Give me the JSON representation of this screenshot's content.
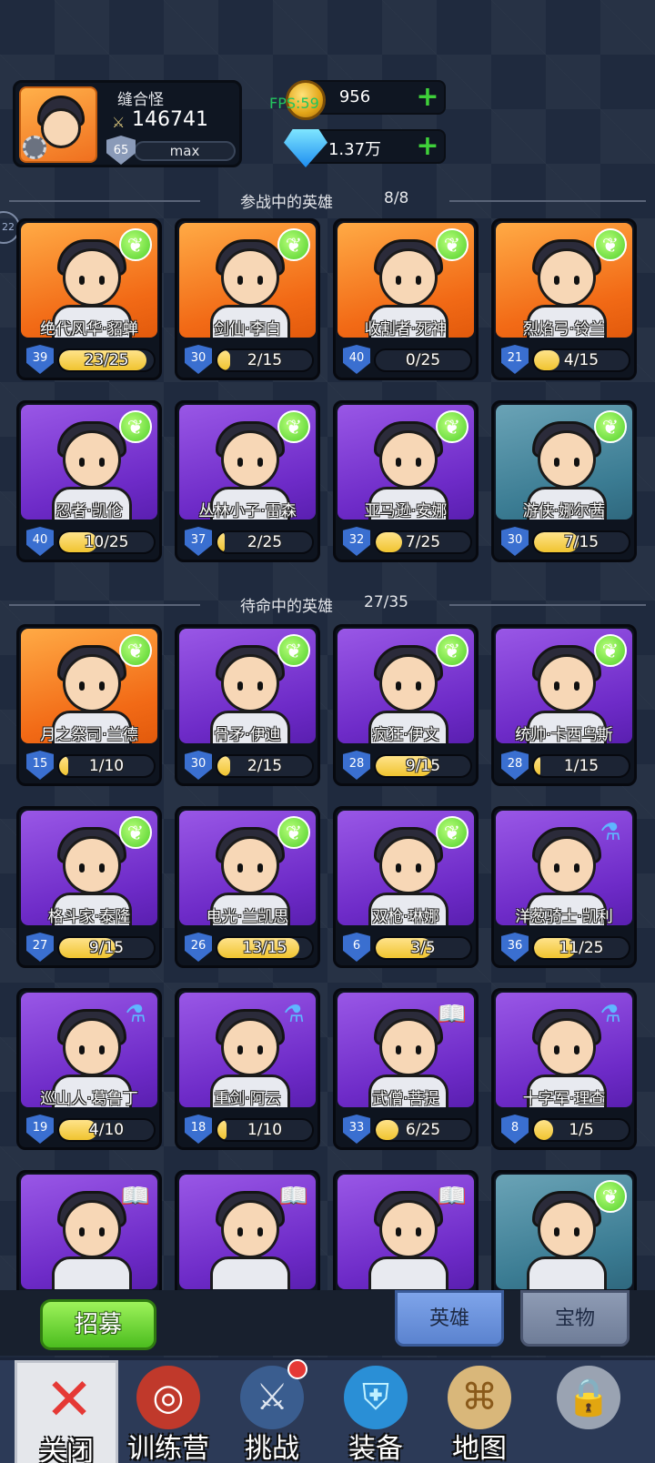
{
  "profile": {
    "name": "缝合怪",
    "power": "146741",
    "level": "65",
    "level_status": "max"
  },
  "currency": {
    "fps": "FPS:59",
    "gold": "956",
    "gems": "1.37万"
  },
  "side_tab": "22",
  "active_section": {
    "title": "参战中的英雄",
    "count": "8/8"
  },
  "standby_section": {
    "title": "待命中的英雄",
    "count": "27/35"
  },
  "active_heroes": [
    {
      "name": "绝代风华·貂蝉",
      "level": "39",
      "progress": "23/25",
      "fill": 0.92,
      "rarity": "orange",
      "badge": "leaf"
    },
    {
      "name": "剑仙·李白",
      "level": "30",
      "progress": "2/15",
      "fill": 0.13,
      "rarity": "orange",
      "badge": "leaf"
    },
    {
      "name": "收割者·死神",
      "level": "40",
      "progress": "0/25",
      "fill": 0.0,
      "rarity": "orange",
      "badge": "leaf"
    },
    {
      "name": "烈焰弓·铃兰",
      "level": "21",
      "progress": "4/15",
      "fill": 0.27,
      "rarity": "orange",
      "badge": "leaf"
    },
    {
      "name": "忍者·凯伦",
      "level": "40",
      "progress": "10/25",
      "fill": 0.4,
      "rarity": "purple",
      "badge": "leaf"
    },
    {
      "name": "丛林小子·雷森",
      "level": "37",
      "progress": "2/25",
      "fill": 0.08,
      "rarity": "purple",
      "badge": "leaf"
    },
    {
      "name": "亚马逊·安娜",
      "level": "32",
      "progress": "7/25",
      "fill": 0.28,
      "rarity": "purple",
      "badge": "leaf"
    },
    {
      "name": "游侠·娜尔茜",
      "level": "30",
      "progress": "7/15",
      "fill": 0.47,
      "rarity": "teal",
      "badge": "leaf"
    }
  ],
  "standby_heroes": [
    {
      "name": "月之祭司·兰德",
      "level": "15",
      "progress": "1/10",
      "fill": 0.1,
      "rarity": "orange",
      "badge": "leaf"
    },
    {
      "name": "骨矛·伊迪",
      "level": "30",
      "progress": "2/15",
      "fill": 0.13,
      "rarity": "purple",
      "badge": "leaf"
    },
    {
      "name": "疯狂·伊文",
      "level": "28",
      "progress": "9/15",
      "fill": 0.6,
      "rarity": "purple",
      "badge": "leaf"
    },
    {
      "name": "统帅·卡西乌斯",
      "level": "28",
      "progress": "1/15",
      "fill": 0.07,
      "rarity": "purple",
      "badge": "leaf"
    },
    {
      "name": "格斗家·泰隆",
      "level": "27",
      "progress": "9/15",
      "fill": 0.6,
      "rarity": "purple",
      "badge": "leaf"
    },
    {
      "name": "电光·兰凯思",
      "level": "26",
      "progress": "13/15",
      "fill": 0.87,
      "rarity": "purple",
      "badge": "leaf"
    },
    {
      "name": "双枪·琳娜",
      "level": "6",
      "progress": "3/5",
      "fill": 0.6,
      "rarity": "purple",
      "badge": "leaf"
    },
    {
      "name": "洋葱骑士·凯利",
      "level": "36",
      "progress": "11/25",
      "fill": 0.44,
      "rarity": "purple",
      "badge": "potion"
    },
    {
      "name": "巡山人·葛鲁丁",
      "level": "19",
      "progress": "4/10",
      "fill": 0.4,
      "rarity": "purple",
      "badge": "potion"
    },
    {
      "name": "重剑·阿云",
      "level": "18",
      "progress": "1/10",
      "fill": 0.1,
      "rarity": "purple",
      "badge": "potion"
    },
    {
      "name": "武僧·菩提",
      "level": "33",
      "progress": "6/25",
      "fill": 0.24,
      "rarity": "purple",
      "badge": "book"
    },
    {
      "name": "十字军·理查",
      "level": "8",
      "progress": "1/5",
      "fill": 0.2,
      "rarity": "purple",
      "badge": "potion"
    },
    {
      "name": "",
      "level": "",
      "progress": "",
      "fill": 0,
      "rarity": "purple",
      "badge": "book"
    },
    {
      "name": "",
      "level": "",
      "progress": "",
      "fill": 0,
      "rarity": "purple",
      "badge": "book"
    },
    {
      "name": "",
      "level": "",
      "progress": "",
      "fill": 0,
      "rarity": "purple",
      "badge": "book"
    },
    {
      "name": "",
      "level": "",
      "progress": "",
      "fill": 0,
      "rarity": "teal",
      "badge": "leaf"
    }
  ],
  "recruit_label": "招募",
  "tabs": {
    "heroes": "英雄",
    "treasure": "宝物"
  },
  "nav": [
    {
      "label": "关闭",
      "icon": "close-icon"
    },
    {
      "label": "训练营",
      "icon": "target-icon"
    },
    {
      "label": "挑战",
      "icon": "sword-icon"
    },
    {
      "label": "装备",
      "icon": "armor-icon"
    },
    {
      "label": "地图",
      "icon": "map-icon"
    },
    {
      "label": "",
      "icon": "lock-icon"
    }
  ],
  "colors": {
    "bg": "#1f2a3e",
    "orange": "#f26a16",
    "purple": "#6e2bc8",
    "teal": "#3b7c93",
    "green": "#4cbd1f",
    "gold": "#f0c430"
  }
}
